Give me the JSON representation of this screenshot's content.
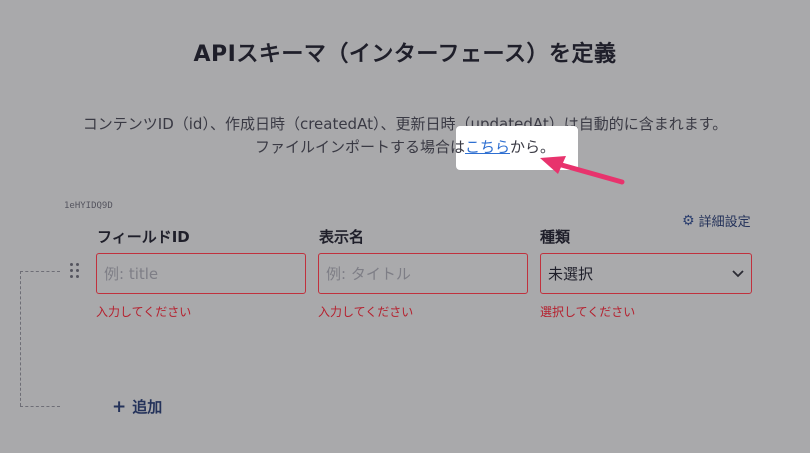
{
  "heading": "APIスキーマ（インターフェース）を定義",
  "description": {
    "line1": "コンテンツID（id）、作成日時（createdAt）、更新日時（updatedAt）は自動的に含まれます。",
    "line2_prefix": "ファイルインポートする場合は",
    "line2_link": "こちら",
    "line2_suffix": "から。"
  },
  "field_row": {
    "id_tag": "1eHYIDQ9D",
    "advanced_settings": "詳細設定",
    "columns": {
      "field_id": "フィールドID",
      "display_name": "表示名",
      "type": "種類"
    },
    "inputs": {
      "field_id_placeholder": "例: title",
      "display_name_placeholder": "例: タイトル",
      "type_value": "未選択"
    },
    "errors": {
      "field_id": "入力してください",
      "display_name": "入力してください",
      "type": "選択してください"
    }
  },
  "add_button": "追加",
  "colors": {
    "overlay": "#a9a9ab",
    "error": "#b5212f",
    "link": "#2e6fd1",
    "accent_arrow": "#e8336d"
  },
  "icons": [
    "gear-icon",
    "drag-handle-icon",
    "chevron-down-icon",
    "plus-icon",
    "arrow-icon"
  ]
}
